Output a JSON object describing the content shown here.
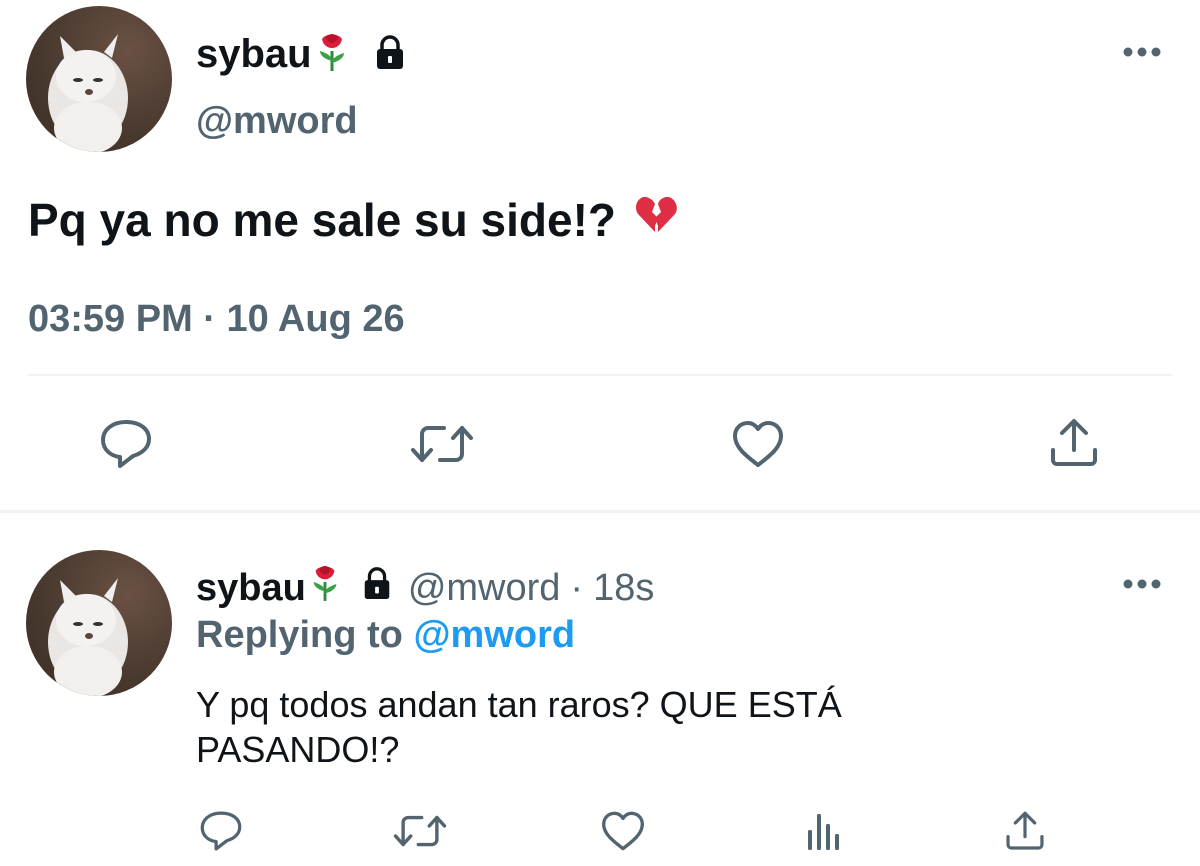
{
  "main_tweet": {
    "display_name": "sybau",
    "handle": "@mword",
    "text": "Pq ya no me sale su side!?",
    "emoji": "💔",
    "timestamp": "03:59 PM · 10 Aug 26",
    "icons": {
      "name_badge": "rose-icon",
      "protected": "lock-icon",
      "more": "more-icon"
    },
    "actions": [
      "reply-icon",
      "retweet-icon",
      "like-icon",
      "share-icon"
    ]
  },
  "reply_tweet": {
    "display_name": "sybau",
    "handle": "@mword",
    "separator": "·",
    "time_ago": "18s",
    "replying_prefix": "Replying to",
    "replying_to": "@mword",
    "text_line1": "Y pq todos andan tan raros? QUE ESTÁ",
    "text_line2": "PASANDO!?",
    "actions": [
      "reply-icon",
      "retweet-icon",
      "like-icon",
      "analytics-icon",
      "share-icon"
    ]
  },
  "colors": {
    "text_primary": "#0f1419",
    "text_secondary": "#536471",
    "accent": "#1d9bf0",
    "divider": "#eff3f4",
    "heart_broken": "#e0245e"
  }
}
